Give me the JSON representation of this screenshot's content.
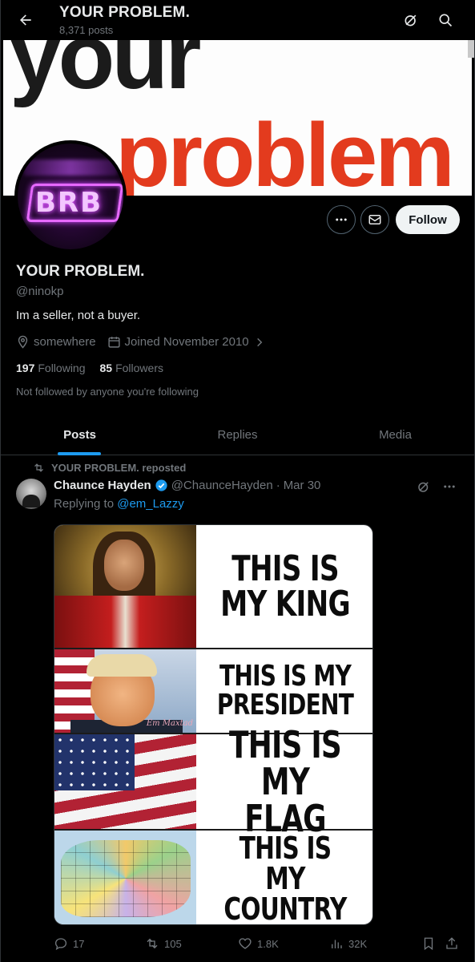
{
  "header": {
    "title": "YOUR PROBLEM.",
    "posts_count": "8,371 posts"
  },
  "banner": {
    "line1": "your",
    "line2": "problem"
  },
  "avatar": {
    "text": "BRB"
  },
  "profile": {
    "follow_label": "Follow",
    "name": "YOUR PROBLEM.",
    "handle": "@ninokp",
    "bio": "Im a seller, not a buyer.",
    "location": "somewhere",
    "joined": "Joined November 2010",
    "following_count": "197",
    "following_label": "Following",
    "followers_count": "85",
    "followers_label": "Followers",
    "not_followed": "Not followed by anyone you're following"
  },
  "tabs": [
    {
      "label": "Posts",
      "active": true
    },
    {
      "label": "Replies",
      "active": false
    },
    {
      "label": "Media",
      "active": false
    }
  ],
  "post": {
    "repost_text": "YOUR PROBLEM. reposted",
    "author": "Chaunce Hayden",
    "handle": "@ChaunceHayden",
    "separator": "·",
    "date": "Mar 30",
    "replying_prefix": "Replying to ",
    "replying_to": "@em_Lazzy",
    "meme_captions": [
      "THIS IS MY KING",
      "THIS IS MY PRESIDENT",
      "THIS IS MY FLAG",
      "THIS IS MY COUNTRY"
    ],
    "meme_watermark": "Em Maxtad",
    "replies": "17",
    "reposts": "105",
    "likes": "1.8K",
    "views": "32K"
  },
  "colors": {
    "accent": "#1d9bf0",
    "background": "#000000",
    "secondary_text": "#71767b",
    "banner_red": "#e33b1e"
  }
}
